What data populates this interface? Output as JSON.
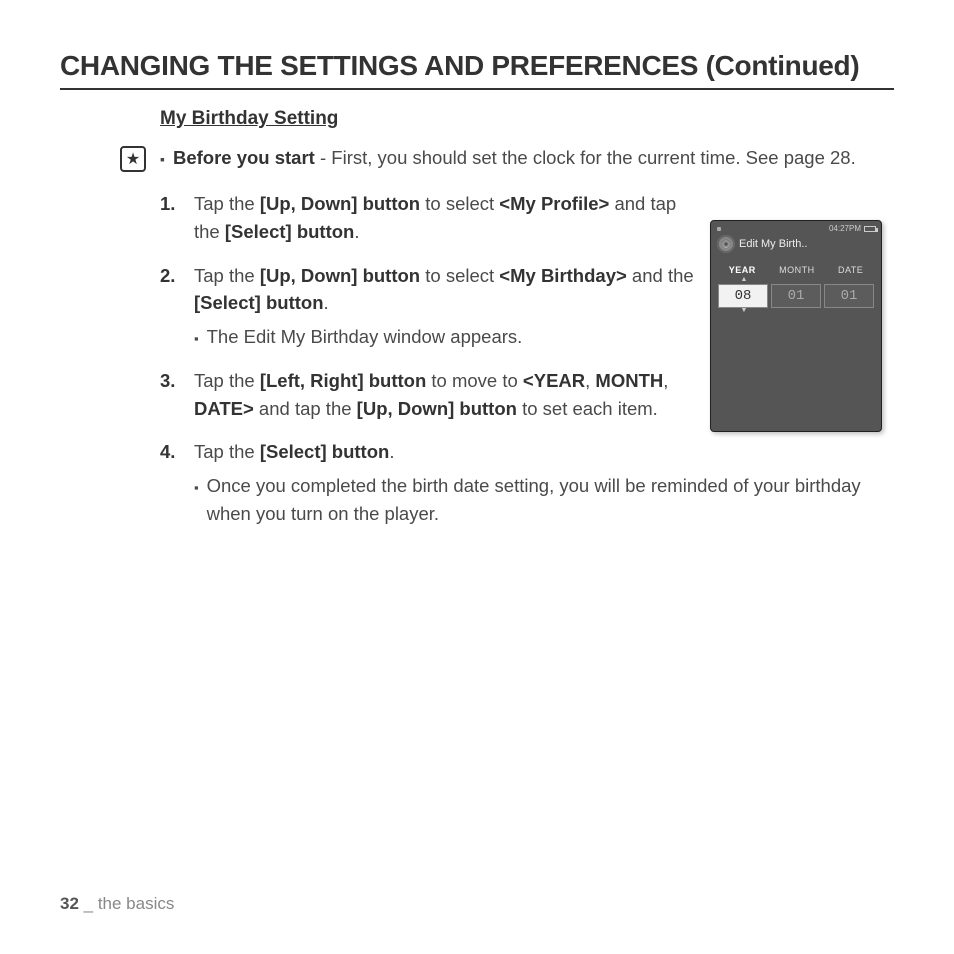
{
  "page_title": "CHANGING THE SETTINGS AND PREFERENCES (Continued)",
  "section_title": "My Birthday Setting",
  "note": {
    "lead": "Before you start",
    "rest": " - First, you should set the clock for the current time. See page 28."
  },
  "steps": {
    "s1": {
      "a": "Tap the ",
      "b": "[Up, Down] button",
      "c": " to select ",
      "d": "<My Profile>",
      "e": " and tap the ",
      "f": "[Select] button",
      "g": "."
    },
    "s2": {
      "a": "Tap the ",
      "b": "[Up, Down] button",
      "c": " to select ",
      "d": "<My Birthday>",
      "e": " and the ",
      "f": "[Select] button",
      "g": ".",
      "sub": "The Edit My Birthday window appears."
    },
    "s3": {
      "a": "Tap the ",
      "b": "[Left, Right] button",
      "c": " to move to ",
      "d": "<YEAR",
      "e": ", ",
      "f": "MONTH",
      "g": ", ",
      "h": "DATE>",
      "i": " and tap the ",
      "j": "[Up, Down] button",
      "k": " to set each item."
    },
    "s4": {
      "a": "Tap the ",
      "b": "[Select] button",
      "c": ".",
      "sub": "Once you completed the birth date setting, you will be reminded of your birthday when you turn on the player."
    }
  },
  "device": {
    "time": "04:27PM",
    "title": "Edit My Birth..",
    "cols": {
      "year": "YEAR",
      "month": "MONTH",
      "date": "DATE"
    },
    "vals": {
      "year": "08",
      "month": "01",
      "date": "01"
    }
  },
  "footer": {
    "page": "32",
    "sep": " _ ",
    "section": "the basics"
  }
}
